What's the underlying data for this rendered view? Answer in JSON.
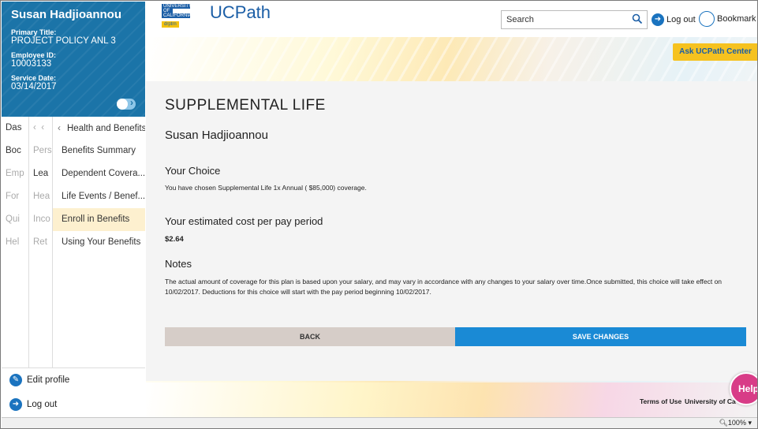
{
  "profile": {
    "name": "Susan Hadjioannou",
    "primary_title_label": "Primary Title:",
    "primary_title": "PROJECT POLICY ANL 3",
    "employee_id_label": "Employee ID:",
    "employee_id": "10003133",
    "service_date_label": "Service Date:",
    "service_date": "03/14/2017"
  },
  "nav": {
    "col1": [
      "Das",
      "Boc",
      "Emp",
      "For",
      "Qui",
      "Hel"
    ],
    "col2": [
      "",
      "Pers",
      "Lea",
      "Hea",
      "Inco",
      "Ret"
    ],
    "col3_back": "Health and Benefits",
    "col3": [
      "Benefits Summary",
      "Dependent Covera...",
      "Life Events / Benef...",
      "Enroll in Benefits",
      "Using Your Benefits"
    ],
    "active": "Enroll in Benefits"
  },
  "sidebar_bottom": {
    "edit_profile": "Edit profile",
    "logout": "Log out"
  },
  "header": {
    "logo_line1": "University",
    "logo_line2": "of",
    "logo_line3": "California",
    "logo_badge": "drptrn",
    "app_title": "UCPath",
    "search_placeholder": "Search",
    "logout": "Log out",
    "bookmark": "Bookmark"
  },
  "main": {
    "ask_button": "Ask UCPath Center",
    "page_title": "SUPPLEMENTAL LIFE",
    "person_name": "Susan Hadjioannou",
    "section1_heading": "Your Choice",
    "section1_text": "You have chosen Supplemental Life 1x Annual ( $85,000) coverage.",
    "section2_heading": "Your estimated cost per pay period",
    "section2_text": "$2.64",
    "section3_heading": "Notes",
    "section3_text": "The actual amount of coverage for this plan is based upon your salary, and may vary in accordance with any changes to your salary over time.Once submitted, this choice will take effect on 10/02/2017. Deductions for this choice will start with the pay period beginning 10/02/2017.",
    "back_button": "BACK",
    "save_button": "SAVE CHANGES"
  },
  "footer": {
    "terms": "Terms of Use",
    "uc_link": "University of Ca",
    "help": "Help"
  },
  "statusbar": {
    "zoom": "100%"
  },
  "colors": {
    "primary_blue": "#1b74a8",
    "save_blue": "#1a8ad5",
    "ask_yellow": "#f6c21f",
    "help_pink": "#d83c87",
    "active_nav": "#fdf0cf"
  }
}
